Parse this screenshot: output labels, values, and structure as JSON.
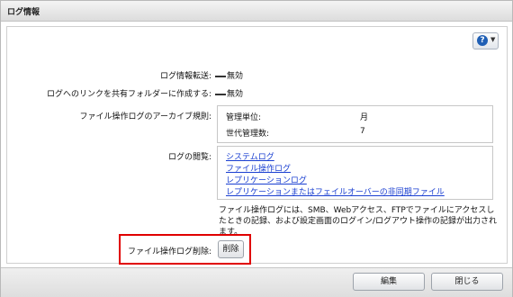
{
  "window": {
    "title": "ログ情報"
  },
  "settings": {
    "log_forwarding": {
      "label": "ログ情報転送:",
      "value": "無効"
    },
    "log_link_folder": {
      "label": "ログへのリンクを共有フォルダーに作成する:",
      "value": "無効"
    },
    "archive_rule": {
      "label": "ファイル操作ログのアーカイブ規則:",
      "unit_label": "管理単位:",
      "unit_value": "月",
      "generations_label": "世代管理数:",
      "generations_value": "7"
    },
    "log_view": {
      "label": "ログの閲覧:",
      "links": [
        "システムログ",
        "ファイル操作ログ",
        "レプリケーションログ",
        "レプリケーションまたはフェイルオーバーの非同期ファイル"
      ]
    },
    "note": "ファイル操作ログには、SMB、Webアクセス、FTPでファイルにアクセスしたときの記録、および設定画面のログイン/ログアウト操作の記録が出力されます。",
    "delete": {
      "label": "ファイル操作ログ削除:",
      "button": "削除"
    }
  },
  "footer": {
    "edit_button": "編集",
    "close_button": "閉じる"
  },
  "colors": {
    "highlight": "#e00000",
    "link": "#1a3fd1",
    "help_icon": "#1f5fb5"
  },
  "icons": {
    "help": "help-icon",
    "dropdown": "chevron-down-icon"
  }
}
